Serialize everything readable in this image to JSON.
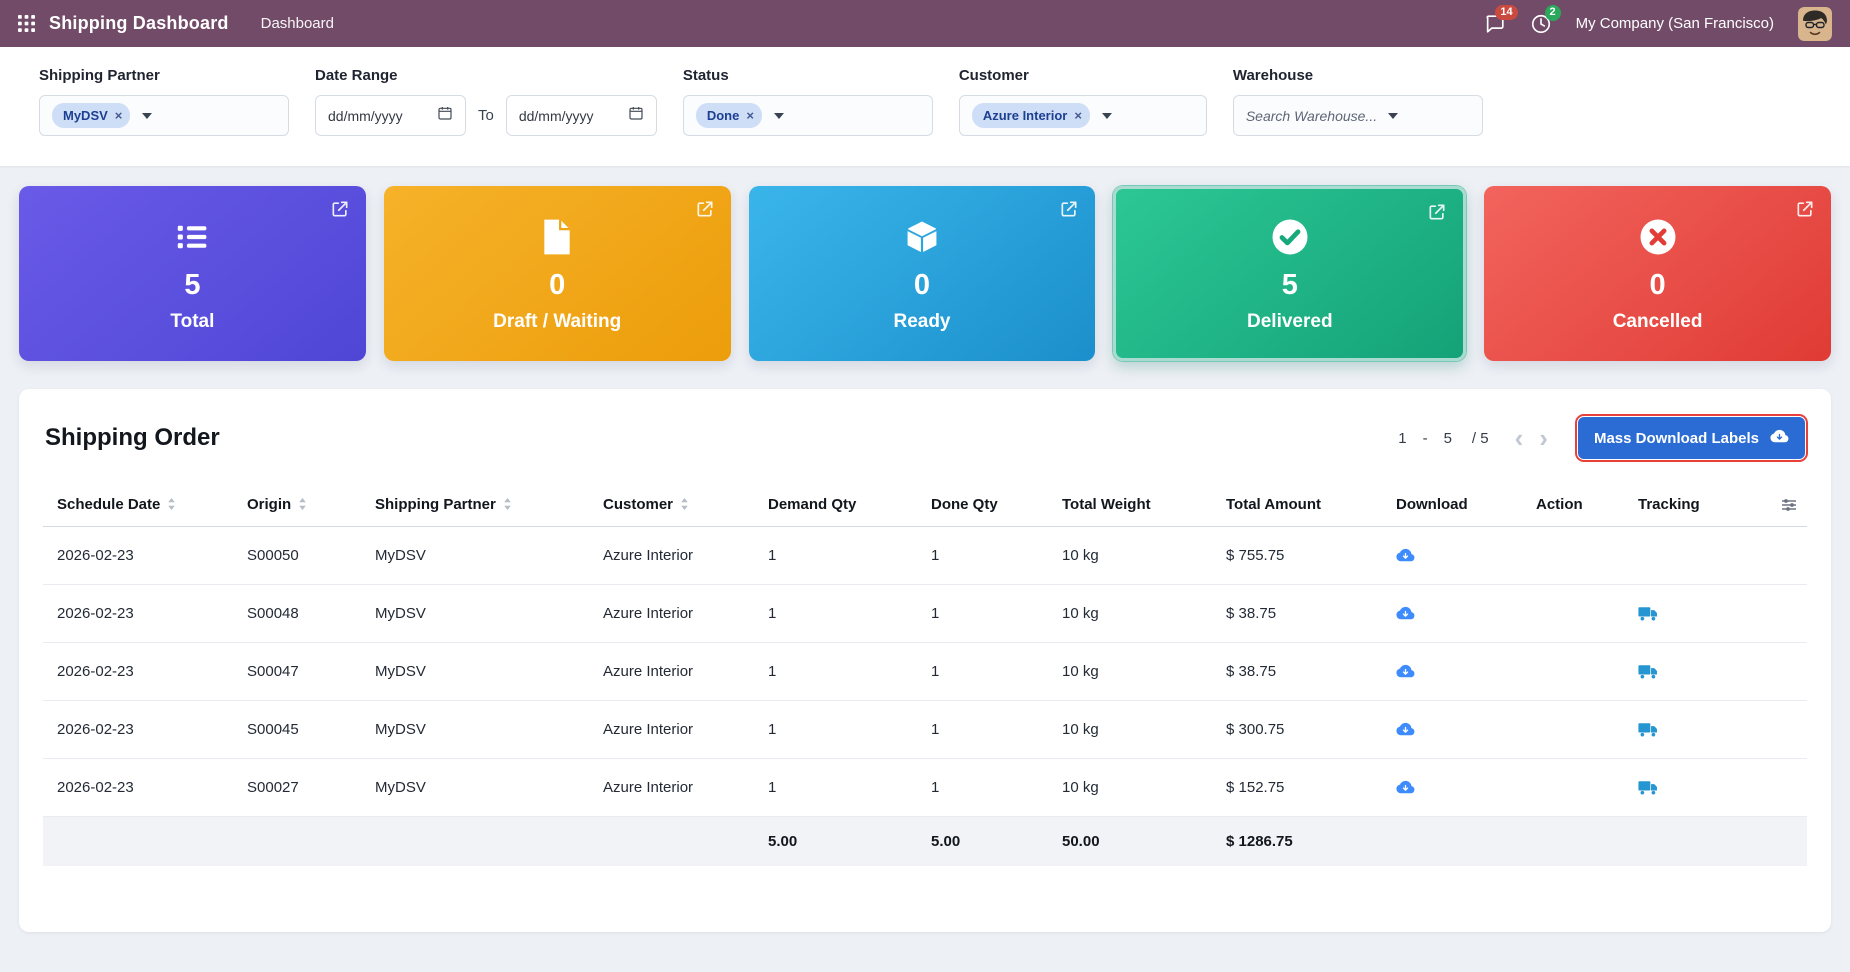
{
  "navbar": {
    "app_title": "Shipping Dashboard",
    "menu_dashboard": "Dashboard",
    "messages_badge": "14",
    "activities_badge": "2",
    "company": "My Company (San Francisco)"
  },
  "filters": {
    "shipping_partner_label": "Shipping Partner",
    "shipping_partner_tag": "MyDSV",
    "date_range_label": "Date Range",
    "date_from_placeholder": "dd/mm/yyyy",
    "date_to_label": "To",
    "date_to_placeholder": "dd/mm/yyyy",
    "status_label": "Status",
    "status_tag": "Done",
    "customer_label": "Customer",
    "customer_tag": "Azure Interior",
    "warehouse_label": "Warehouse",
    "warehouse_placeholder": "Search Warehouse..."
  },
  "icons": {
    "remove_tag": "×",
    "chevron_prev": "‹",
    "chevron_next": "›"
  },
  "cards": [
    {
      "value": "5",
      "label": "Total",
      "icon": "list-icon",
      "color_from": "#6a5ae8",
      "color_to": "#4f46d6",
      "selected": false
    },
    {
      "value": "0",
      "label": "Draft / Waiting",
      "icon": "file-icon",
      "color_from": "#f6b22a",
      "color_to": "#ec9d0a",
      "selected": false
    },
    {
      "value": "0",
      "label": "Ready",
      "icon": "box-icon",
      "color_from": "#3ab5ea",
      "color_to": "#1b8fcb",
      "selected": false
    },
    {
      "value": "5",
      "label": "Delivered",
      "icon": "check-circle-icon",
      "color_from": "#2cc795",
      "color_to": "#14a277",
      "selected": true
    },
    {
      "value": "0",
      "label": "Cancelled",
      "icon": "x-circle-icon",
      "color_from": "#f2645d",
      "color_to": "#e03b35",
      "selected": false
    }
  ],
  "orders": {
    "title": "Shipping Order",
    "pagination": {
      "start": "1",
      "dash": "-",
      "end": "5",
      "total": "/ 5"
    },
    "mass_download_button": "Mass Download Labels",
    "columns": [
      {
        "label": "Schedule Date",
        "sortable": true
      },
      {
        "label": "Origin",
        "sortable": true
      },
      {
        "label": "Shipping Partner",
        "sortable": true
      },
      {
        "label": "Customer",
        "sortable": true
      },
      {
        "label": "Demand Qty",
        "sortable": false
      },
      {
        "label": "Done Qty",
        "sortable": false
      },
      {
        "label": "Total Weight",
        "sortable": false
      },
      {
        "label": "Total Amount",
        "sortable": false
      },
      {
        "label": "Download",
        "sortable": false
      },
      {
        "label": "Action",
        "sortable": false
      },
      {
        "label": "Tracking",
        "sortable": false
      }
    ],
    "rows": [
      {
        "schedule_date": "2026-02-23",
        "origin": "S00050",
        "shipping_partner": "MyDSV",
        "customer": "Azure Interior",
        "demand_qty": "1",
        "done_qty": "1",
        "total_weight": "10 kg",
        "total_amount": "$ 755.75",
        "download": true,
        "action": "",
        "tracking": false
      },
      {
        "schedule_date": "2026-02-23",
        "origin": "S00048",
        "shipping_partner": "MyDSV",
        "customer": "Azure Interior",
        "demand_qty": "1",
        "done_qty": "1",
        "total_weight": "10 kg",
        "total_amount": "$ 38.75",
        "download": true,
        "action": "",
        "tracking": true
      },
      {
        "schedule_date": "2026-02-23",
        "origin": "S00047",
        "shipping_partner": "MyDSV",
        "customer": "Azure Interior",
        "demand_qty": "1",
        "done_qty": "1",
        "total_weight": "10 kg",
        "total_amount": "$ 38.75",
        "download": true,
        "action": "",
        "tracking": true
      },
      {
        "schedule_date": "2026-02-23",
        "origin": "S00045",
        "shipping_partner": "MyDSV",
        "customer": "Azure Interior",
        "demand_qty": "1",
        "done_qty": "1",
        "total_weight": "10 kg",
        "total_amount": "$ 300.75",
        "download": true,
        "action": "",
        "tracking": true
      },
      {
        "schedule_date": "2026-02-23",
        "origin": "S00027",
        "shipping_partner": "MyDSV",
        "customer": "Azure Interior",
        "demand_qty": "1",
        "done_qty": "1",
        "total_weight": "10 kg",
        "total_amount": "$ 152.75",
        "download": true,
        "action": "",
        "tracking": true
      }
    ],
    "totals": {
      "demand_qty": "5.00",
      "done_qty": "5.00",
      "total_weight": "50.00",
      "total_amount": "$ 1286.75"
    }
  },
  "colors": {
    "navbar_bg": "#714B67",
    "primary_button": "#2b6cd4",
    "highlight_outline": "#e8413c",
    "download_icon": "#3d8bfd",
    "truck_icon": "#2596d1",
    "messages_badge_bg": "#cb4a3f",
    "activities_badge_bg": "#2aa85c"
  }
}
